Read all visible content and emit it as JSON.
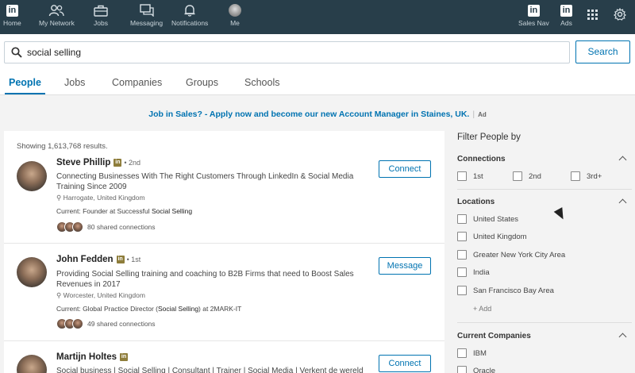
{
  "nav": {
    "items": [
      {
        "label": "Home",
        "icon": "linkedin-logo"
      },
      {
        "label": "My Network",
        "icon": "people-icon"
      },
      {
        "label": "Jobs",
        "icon": "briefcase-icon"
      },
      {
        "label": "Messaging",
        "icon": "chat-icon"
      },
      {
        "label": "Notifications",
        "icon": "bell-icon"
      },
      {
        "label": "Me",
        "icon": "avatar"
      }
    ],
    "right_items": [
      {
        "label": "Sales Nav",
        "icon": "linkedin-logo"
      },
      {
        "label": "Ads",
        "icon": "linkedin-logo"
      }
    ],
    "accent": "#283e4a"
  },
  "search": {
    "value": "social selling",
    "button_label": "Search"
  },
  "tabs": [
    {
      "label": "People",
      "active": true
    },
    {
      "label": "Jobs",
      "active": false
    },
    {
      "label": "Companies",
      "active": false
    },
    {
      "label": "Groups",
      "active": false
    },
    {
      "label": "Schools",
      "active": false
    }
  ],
  "ad": {
    "text": "Job in Sales? - Apply now and become our new Account Manager in Staines, UK.",
    "tag": "Ad"
  },
  "results": {
    "count_text": "Showing 1,613,768 results.",
    "items": [
      {
        "name": "Steve Phillip",
        "degree": "• 2nd",
        "headline": "Connecting Businesses With The Right Customers Through LinkedIn & Social Media Training Since 2009",
        "location": "Harrogate, United Kingdom",
        "current_prefix": "Current: Founder at Successful ",
        "current_bold": "Social Selling",
        "current_suffix": "",
        "shared": "80 shared connections",
        "action": "Connect"
      },
      {
        "name": "John Fedden",
        "degree": "• 1st",
        "headline": "Providing Social Selling training and coaching to B2B Firms that need to Boost Sales Revenues in 2017",
        "location": "Worcester, United Kingdom",
        "current_prefix": "Current: Global Practice Director (",
        "current_bold": "Social Selling",
        "current_suffix": ") at 2MARK-IT",
        "shared": "49 shared connections",
        "action": "Message"
      },
      {
        "name": "Martijn Holtes",
        "degree": "",
        "headline": "Social business | Social Selling | Consultant | Trainer | Social Media | Verkent de wereld",
        "location": "",
        "current_prefix": "",
        "current_bold": "",
        "current_suffix": "",
        "shared": "",
        "action": "Connect"
      }
    ]
  },
  "filters": {
    "title": "Filter People by",
    "connections": {
      "heading": "Connections",
      "options": [
        "1st",
        "2nd",
        "3rd+"
      ]
    },
    "locations": {
      "heading": "Locations",
      "options": [
        "United States",
        "United Kingdom",
        "Greater New York City Area",
        "India",
        "San Francisco Bay Area"
      ],
      "add_label": "+ Add"
    },
    "companies": {
      "heading": "Current Companies",
      "options": [
        "IBM",
        "Oracle"
      ]
    }
  }
}
